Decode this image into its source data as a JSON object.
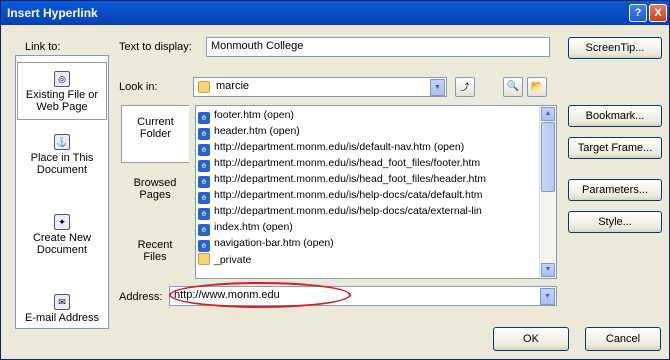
{
  "window": {
    "title": "Insert Hyperlink",
    "help_btn": "?",
    "close_btn": "X"
  },
  "link_to": {
    "label": "Link to:",
    "items": [
      {
        "line1": "Existing File or",
        "line2": "Web Page",
        "icon": "globe-page-icon"
      },
      {
        "line1": "Place in This",
        "line2": "Document",
        "icon": "document-anchor-icon"
      },
      {
        "line1": "Create New",
        "line2": "Document",
        "icon": "new-document-icon"
      },
      {
        "line1": "E-mail Address",
        "line2": "",
        "icon": "email-icon"
      }
    ]
  },
  "text_to_display": {
    "label": "Text to display:",
    "value": "Monmouth College"
  },
  "screentip_button": "ScreenTip...",
  "look_in": {
    "label": "Look in:",
    "value": "marcie"
  },
  "side_tabs": [
    {
      "line1": "Current",
      "line2": "Folder"
    },
    {
      "line1": "Browsed",
      "line2": "Pages"
    },
    {
      "line1": "Recent",
      "line2": "Files"
    }
  ],
  "files": [
    {
      "name": "footer.htm (open)",
      "icon": "web-page-icon"
    },
    {
      "name": "header.htm (open)",
      "icon": "web-page-icon"
    },
    {
      "name": "http://department.monm.edu/is/default-nav.htm (open)",
      "icon": "web-page-icon"
    },
    {
      "name": "http://department.monm.edu/is/head_foot_files/footer.htm",
      "icon": "web-page-icon"
    },
    {
      "name": "http://department.monm.edu/is/head_foot_files/header.htm",
      "icon": "web-page-icon"
    },
    {
      "name": "http://department.monm.edu/is/help-docs/cata/default.htm",
      "icon": "web-page-icon"
    },
    {
      "name": "http://department.monm.edu/is/help-docs/cata/external-lin",
      "icon": "web-page-icon"
    },
    {
      "name": "index.htm (open)",
      "icon": "web-page-icon"
    },
    {
      "name": "navigation-bar.htm (open)",
      "icon": "web-page-icon"
    },
    {
      "name": "_private",
      "icon": "folder-icon"
    }
  ],
  "right_buttons": [
    "Bookmark...",
    "Target Frame...",
    "Parameters...",
    "Style..."
  ],
  "address": {
    "label": "Address:",
    "value": "http://www.monm.edu"
  },
  "ok_button": "OK",
  "cancel_button": "Cancel"
}
